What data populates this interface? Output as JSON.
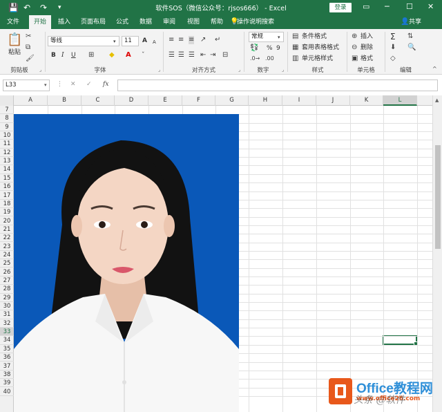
{
  "titlebar": {
    "title": "软件SOS（微信公众号：rjsos666） - Excel",
    "login_label": "登录",
    "save_icon": "save-icon",
    "undo_icon": "undo-icon",
    "redo_icon": "redo-icon",
    "min_glyph": "─",
    "restore_glyph": "☐",
    "close_glyph": "✕",
    "ribbon_toggle_glyph": "▭"
  },
  "tabs": [
    {
      "label": "文件"
    },
    {
      "label": "开始"
    },
    {
      "label": "插入"
    },
    {
      "label": "页面布局"
    },
    {
      "label": "公式"
    },
    {
      "label": "数据"
    },
    {
      "label": "审阅"
    },
    {
      "label": "视图"
    },
    {
      "label": "帮助"
    }
  ],
  "tell_me": "操作说明搜索",
  "share": "共享",
  "ribbon": {
    "clipboard": {
      "label": "剪贴板",
      "paste": "粘贴"
    },
    "font": {
      "label": "字体",
      "name": "等线",
      "size": "11",
      "bold": "B",
      "italic": "I",
      "underline": "U",
      "grow": "A",
      "shrink": "A"
    },
    "alignment": {
      "label": "对齐方式"
    },
    "number": {
      "label": "数字",
      "format": "常规",
      "percent": "%",
      "comma": "9"
    },
    "styles": {
      "label": "样式",
      "conditional": "条件格式",
      "table": "套用表格格式",
      "cell": "单元格样式"
    },
    "cells": {
      "label": "单元格",
      "insert": "插入",
      "delete": "删除",
      "format": "格式"
    },
    "editing": {
      "label": "编辑",
      "sum": "Σ"
    }
  },
  "formula_bar": {
    "name_box": "L33",
    "cancel": "✕",
    "enter": "✓",
    "fx": "fx",
    "value": ""
  },
  "columns": [
    "A",
    "B",
    "C",
    "D",
    "E",
    "F",
    "G",
    "H",
    "I",
    "J",
    "K",
    "L"
  ],
  "rows": [
    "7",
    "8",
    "9",
    "10",
    "11",
    "12",
    "13",
    "14",
    "15",
    "16",
    "17",
    "18",
    "19",
    "20",
    "21",
    "22",
    "23",
    "24",
    "25",
    "26",
    "27",
    "28",
    "29",
    "30",
    "31",
    "32",
    "33",
    "34",
    "35",
    "36",
    "37",
    "38",
    "39",
    "40"
  ],
  "selected_cell": {
    "column": "L",
    "row": "33"
  },
  "photo_bg_color": "#0a58b8",
  "accent_color": "#217346",
  "watermark": {
    "title": "Office教程网",
    "url": "www.office26.com",
    "overlay": "头条 @软件"
  }
}
